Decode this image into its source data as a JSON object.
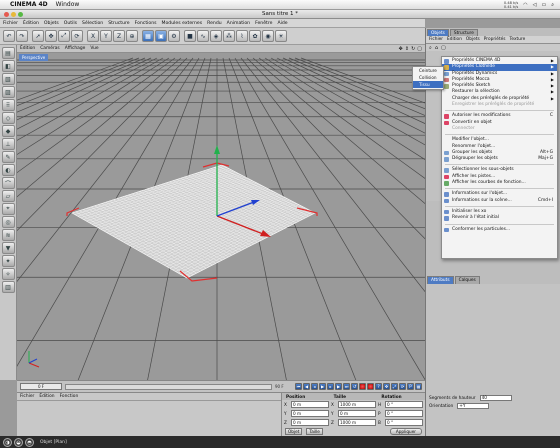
{
  "mac_menubar": {
    "app_name": "CINEMA 4D",
    "window_menu": "Window",
    "clock_line1": "0.48 k/s",
    "clock_line2": "0.41 k/s"
  },
  "window": {
    "title": "Sans titre 1 *"
  },
  "menubar": {
    "items": [
      "Fichier",
      "Édition",
      "Objets",
      "Outils",
      "Sélection",
      "Structure",
      "Fonctions",
      "Modules externes",
      "Rendu",
      "Animation",
      "Fenêtre",
      "Aide"
    ]
  },
  "viewport": {
    "menu": [
      "Édition",
      "Caméras",
      "Affichage",
      "Vue"
    ],
    "label": "Perspective"
  },
  "timeline": {
    "current_frame": "0 F",
    "end_frame": "90 F"
  },
  "material_manager": {
    "menu": [
      "Fichier",
      "Édition",
      "Fonction"
    ]
  },
  "coordinates": {
    "headers": [
      "Position",
      "Taille",
      "Rotation"
    ],
    "rows": [
      {
        "axis": "X",
        "position": "0 m",
        "size": "1000 m",
        "rot_axis": "H",
        "rotation": "0 °"
      },
      {
        "axis": "Y",
        "position": "0 m",
        "size": "0 m",
        "rot_axis": "P",
        "rotation": "0 °"
      },
      {
        "axis": "Z",
        "position": "0 m",
        "size": "1000 m",
        "rot_axis": "B",
        "rotation": "0 °"
      }
    ],
    "mode_select": "Objet",
    "size_select": "Taille",
    "apply": "Appliquer"
  },
  "status_bar": {
    "text": "Objet [Plan]"
  },
  "right_panel": {
    "tabs": [
      "Objets",
      "Structure"
    ],
    "menu": [
      "Fichier",
      "Édition",
      "Objets",
      "Propriétés",
      "Texture"
    ],
    "attr_tabs": [
      "Attributs",
      "Calques"
    ],
    "attr_rows": [
      {
        "label": "Segments de hauteur",
        "value": "40"
      },
      {
        "label": "Orientation",
        "value": "+Y"
      }
    ]
  },
  "context_menu": {
    "items": [
      {
        "label": "Propriétés CINEMA 4D",
        "arrow": true,
        "icon": "#6a8fcc"
      },
      {
        "label": "Propriétés Clothilde",
        "arrow": true,
        "highlight": true,
        "icon": "#d8b04a"
      },
      {
        "label": "Propriétés Dynamics",
        "arrow": true,
        "icon": "#7aa0d0"
      },
      {
        "label": "Propriétés Mocca",
        "arrow": true,
        "icon": "#c77"
      },
      {
        "label": "Propriétés Sketch",
        "arrow": true,
        "icon": "#9a7"
      },
      {
        "label": "Restaurer la sélection",
        "arrow": true
      },
      {
        "label": "Charger des préréglés de propriété",
        "arrow": true
      },
      {
        "label": "Enregistrer les préréglés de propriété",
        "disabled": true
      },
      {
        "sep": true
      },
      {
        "label": "Autoriser les modifications",
        "shortcut": "C",
        "icon": "#d46"
      },
      {
        "label": "Convertir en objet",
        "icon": "#d46"
      },
      {
        "label": "Connecter",
        "disabled": true
      },
      {
        "sep": true
      },
      {
        "label": "Modifier l'objet..."
      },
      {
        "label": "Renommer l'objet..."
      },
      {
        "label": "Grouper les objets",
        "shortcut": "Alt+G",
        "icon": "#7aa0d0"
      },
      {
        "label": "Dégrouper les objets",
        "shortcut": "Maj+G",
        "icon": "#7aa0d0"
      },
      {
        "sep": true
      },
      {
        "label": "Sélectionner les sous-objets",
        "icon": "#7aa0d0"
      },
      {
        "label": "Afficher les pistes...",
        "icon": "#d46"
      },
      {
        "label": "Afficher les courbes de fonction...",
        "icon": "#6a6"
      },
      {
        "sep": true
      },
      {
        "label": "Informations sur l'objet...",
        "icon": "#6a8fcc"
      },
      {
        "label": "Informations sur la scène...",
        "shortcut": "Cmd+I",
        "icon": "#6a8fcc"
      },
      {
        "sep": true
      },
      {
        "label": "Initialiser les xo",
        "icon": "#6a8fcc"
      },
      {
        "label": "Revenir à l'état initial",
        "icon": "#6a8fcc"
      },
      {
        "sep": true
      },
      {
        "label": "Conformer les particules...",
        "icon": "#6a8fcc"
      }
    ]
  },
  "submenu": {
    "items": [
      {
        "label": "Ceinture"
      },
      {
        "label": "Collision"
      },
      {
        "label": "Tissu",
        "highlight": true
      }
    ]
  },
  "colors": {
    "accent_blue": "#3d6fc1",
    "axis_green": "#22b14c",
    "axis_red": "#d02020",
    "axis_blue": "#2040d0",
    "selection_red": "#e03030"
  }
}
